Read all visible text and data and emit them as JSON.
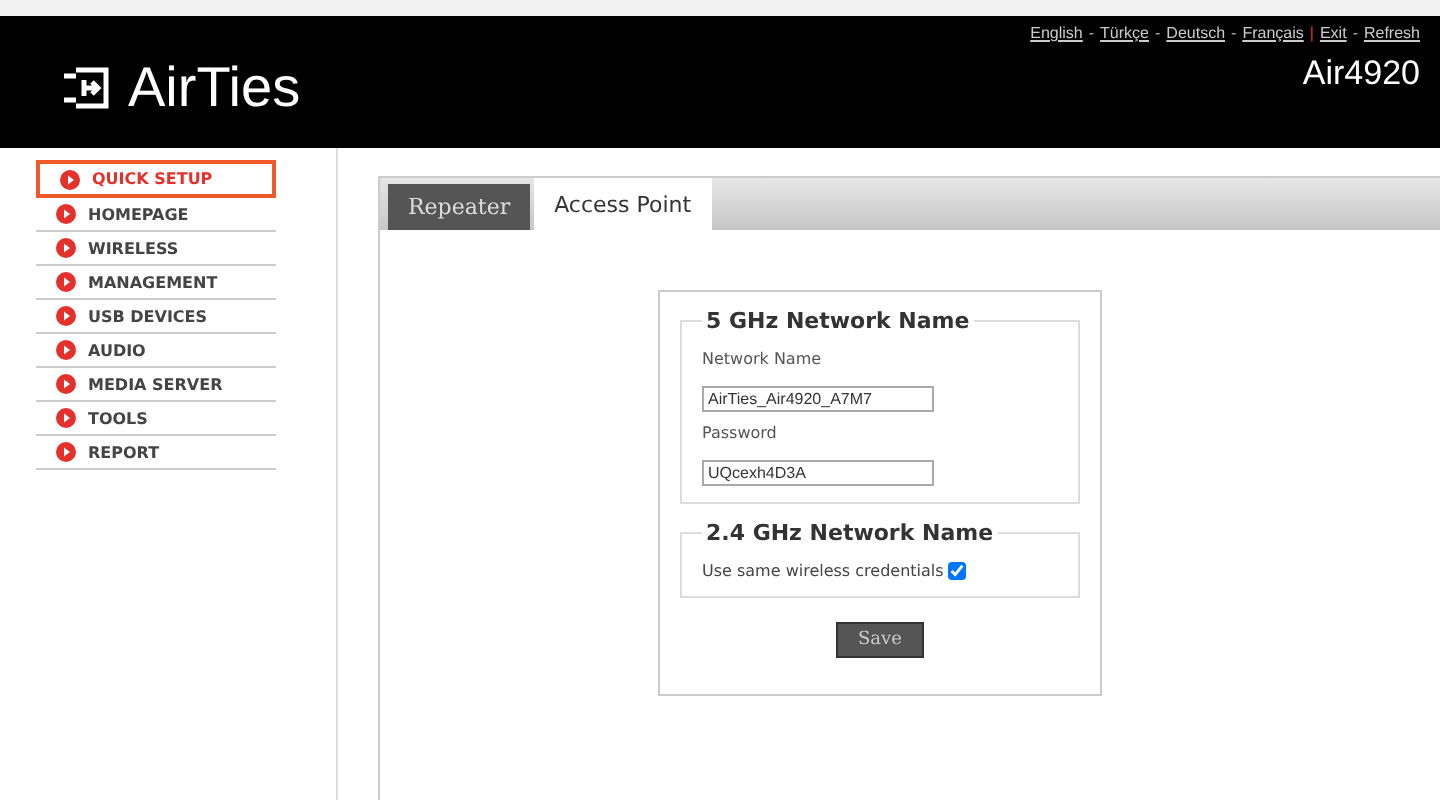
{
  "header": {
    "logo": "AirTies",
    "model": "Air4920",
    "links": [
      {
        "kind": "link",
        "text": "English"
      },
      {
        "kind": "separator",
        "text": "-"
      },
      {
        "kind": "link",
        "text": "Türkçe"
      },
      {
        "kind": "separator",
        "text": "-"
      },
      {
        "kind": "link",
        "text": "Deutsch"
      },
      {
        "kind": "separator",
        "text": "-"
      },
      {
        "kind": "link",
        "text": "Français"
      },
      {
        "kind": "divider",
        "text": "|"
      },
      {
        "kind": "link",
        "text": "Exit"
      },
      {
        "kind": "separator",
        "text": "-"
      },
      {
        "kind": "link",
        "text": "Refresh"
      }
    ]
  },
  "sidebar": {
    "items": [
      {
        "label": "QUICK SETUP",
        "selected": true
      },
      {
        "label": "HOMEPAGE",
        "selected": false
      },
      {
        "label": "WIRELESS",
        "selected": false
      },
      {
        "label": "MANAGEMENT",
        "selected": false
      },
      {
        "label": "USB DEVICES",
        "selected": false
      },
      {
        "label": "AUDIO",
        "selected": false
      },
      {
        "label": "MEDIA SERVER",
        "selected": false
      },
      {
        "label": "TOOLS",
        "selected": false
      },
      {
        "label": "REPORT",
        "selected": false
      }
    ]
  },
  "tabs": [
    {
      "label": "Repeater",
      "selected": false
    },
    {
      "label": "Access Point",
      "selected": true
    }
  ],
  "form": {
    "section_5ghz": {
      "legend": "5 GHz Network Name",
      "network_name_label": "Network Name",
      "network_name": "AirTies_Air4920_A7M7",
      "password_label": "Password",
      "password": "UQcexh4D3A"
    },
    "section_24ghz": {
      "legend": "2.4 GHz Network Name",
      "same_credentials_label": "Use same wireless credentials",
      "same_credentials_checked": true
    },
    "save_button": "Save"
  }
}
